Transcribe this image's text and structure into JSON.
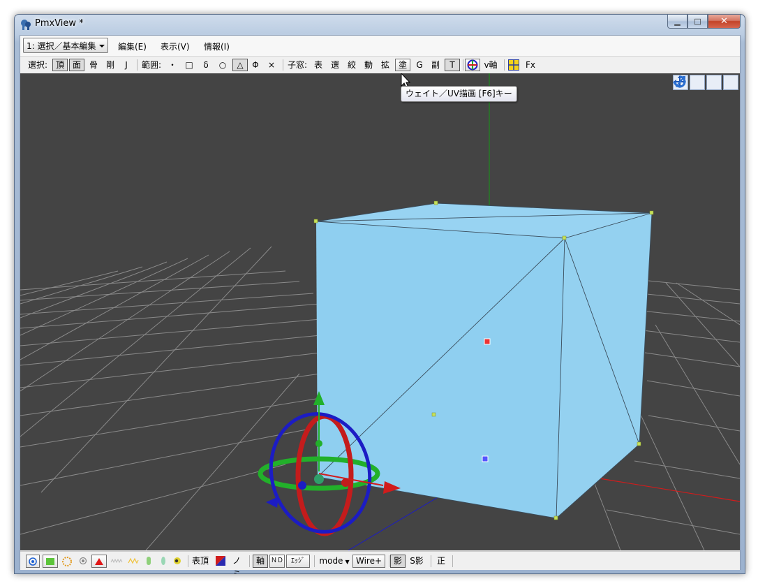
{
  "window": {
    "title": "PmxView *",
    "minimize": "▁",
    "maximize": "□",
    "close": "✕"
  },
  "menubar": {
    "mode_selected": "1: 選択／基本編集",
    "items": [
      "編集(E)",
      "表示(V)",
      "情報(I)"
    ]
  },
  "toolbar": {
    "select_label": "選択:",
    "select_items": [
      "頂",
      "面",
      "骨",
      "剛",
      "J"
    ],
    "range_label": "範囲:",
    "range_items": [
      "・",
      "□",
      "δ",
      "○",
      "△",
      "Φ",
      "×"
    ],
    "child_label": "子窓:",
    "child_items": [
      "表",
      "選",
      "絞",
      "動",
      "拡",
      "塗",
      "G",
      "副",
      "T"
    ],
    "vaxis_label": "v軸",
    "fx_label": "Fx"
  },
  "tooltip": {
    "text": "ウェイト／UV描画 [F6]キー"
  },
  "statusbar": {
    "surface_vertex": "表頂",
    "no_label": "ノミ",
    "axis_label": "軸",
    "mode_label": "mode",
    "wire_label": "Wire+",
    "shadow_label": "影",
    "sshadow_label": "S影",
    "correct_label": "正",
    "ed_label": "ｴｯｼﾞ",
    "nd_label": "ＮＤ"
  },
  "colors": {
    "viewport_bg": "#444444",
    "cube_fill": "#8fcff0",
    "grid": "#8a8a8a",
    "gizmo_red": "#d11c1c",
    "gizmo_green": "#22b02a",
    "gizmo_blue": "#1c1cc4"
  }
}
